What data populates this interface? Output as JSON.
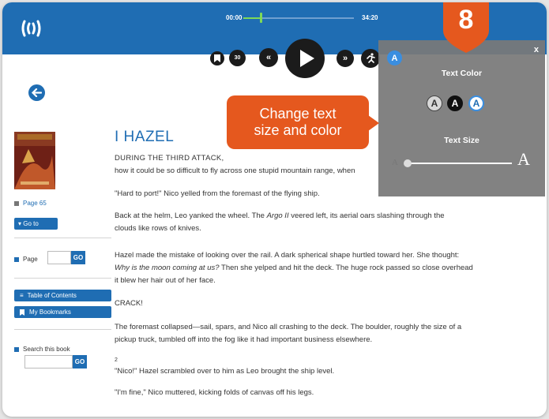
{
  "colors": {
    "brand_blue": "#1f6db3",
    "accent_orange": "#e5581e",
    "panel_grey": "#787878",
    "progress_green": "#7ed957"
  },
  "player": {
    "logo_icon": "audio-waves-logo",
    "time_elapsed": "00:00",
    "time_total": "34:20",
    "progress_fraction": 0.02,
    "controls": [
      "bookmark-icon",
      "replay-30-icon",
      "rewind-icon",
      "play-icon",
      "fast-forward-icon",
      "running-man-icon",
      "text-settings-icon"
    ],
    "replay_label": "30"
  },
  "text_panel": {
    "close_label": "x",
    "toggle_label": "A",
    "color_heading": "Text Color",
    "swatches": [
      "A",
      "A",
      "A"
    ],
    "size_heading": "Text Size",
    "size_small_label": "A",
    "size_large_label": "A"
  },
  "callout": {
    "step_number": "8",
    "tooltip_line1": "Change text",
    "tooltip_line2": "size and color"
  },
  "sidebar": {
    "page_indicator": "Page 65",
    "goto_label": "▾ Go to",
    "page_label": "Page",
    "go_label": "GO",
    "toc_label": "Table of Contents",
    "bookmarks_label": "My Bookmarks",
    "search_label": "Search this book",
    "search_go_label": "GO"
  },
  "book": {
    "chapter_title": "I HAZEL",
    "line1": "DURING THE THIRD ATTACK, ",
    "line1b": "how it could be so difficult to fly across one stupid mountain range, when",
    "p2": "\"Hard to port!\" Nico yelled from the foremast of the flying ship.",
    "p3a": "Back at the helm, Leo yanked the wheel. The ",
    "p3_ship": "Argo II",
    "p3b": " veered left, its aerial oars slashing through the",
    "p3c": "clouds like rows of knives.",
    "p4a": "Hazel made the mistake of looking over the rail. A dark spherical shape hurtled toward her. She thought:",
    "p4_thought": "Why is the moon coming at us?",
    "p4b": " Then she yelped and hit the deck. The huge rock passed so close overhead",
    "p4c": "it blew her hair out of her face.",
    "p5": "CRACK!",
    "p6a": "The foremast collapsed—sail, spars, and Nico all crashing to the deck. The boulder, roughly the size of a",
    "p6b": "pickup truck, tumbled off into the fog like it had important business elsewhere.",
    "page_num": "2",
    "p7": "\"Nico!\" Hazel scrambled over to him as Leo brought the ship level.",
    "p8": "\"I'm fine,\" Nico muttered, kicking folds of canvas off his legs."
  }
}
